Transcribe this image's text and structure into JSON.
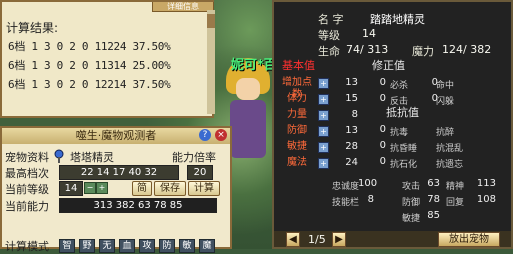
{
  "npc_name": "妮可*百",
  "calc": {
    "title": "计算结果:",
    "tab_label": "详细信息",
    "rows": [
      "6档 1 3 0 2 0 11224 37.50%",
      "6档 1 3 0 2 0 11314 25.00%",
      "6档 1 3 0 2 0 12214 37.50%"
    ]
  },
  "observer": {
    "title": "噬生·魔物观测者",
    "help_icon": "?",
    "close_icon": "×",
    "pet_info_label": "宠物资料",
    "pet_name": "塔塔精灵",
    "ability_rate_label": "能力倍率",
    "max_level_label": "最高档次",
    "max_level_value": "22 14 17 40 32",
    "max_level_extra": "20",
    "current_level_label": "当前等级",
    "current_level_value": "14",
    "btn_simple": "简",
    "btn_save": "保存",
    "btn_calc": "计算",
    "current_ability_label": "当前能力",
    "current_ability_value": "313 382 63 78 85",
    "mode_label": "计算模式",
    "modes": [
      "智",
      "野",
      "无",
      "血",
      "攻",
      "防",
      "敏",
      "魔"
    ]
  },
  "pet": {
    "name_label": "名 字",
    "name_value": "踏踏地精灵",
    "level_label": "等级",
    "level_value": "14",
    "hp_label": "生命",
    "hp_value": "74/ 313",
    "mp_label": "魔力",
    "mp_value": "124/ 382",
    "basic_head": "基本值",
    "modifier_head": "修正值",
    "resist_head": "抵抗值",
    "basic": [
      {
        "label": "增加点数",
        "value": "13"
      },
      {
        "label": "体力",
        "value": "15"
      },
      {
        "label": "力量",
        "value": "8"
      },
      {
        "label": "防御",
        "value": "13"
      },
      {
        "label": "敏捷",
        "value": "28"
      },
      {
        "label": "魔法",
        "value": "24"
      }
    ],
    "modifier": [
      {
        "label": "必杀",
        "value": "0",
        "label2": "命中",
        "value2": "0"
      },
      {
        "label": "反击",
        "value": "0",
        "label2": "闪躲",
        "value2": "0"
      }
    ],
    "resist": [
      {
        "label": "抗毒",
        "value": "0",
        "label2": "抗醉",
        "value2": ""
      },
      {
        "label": "抗昏睡",
        "value": "0",
        "label2": "抗混乱",
        "value2": ""
      },
      {
        "label": "抗石化",
        "value": "0",
        "label2": "抗遗忘",
        "value2": ""
      }
    ],
    "loyalty_label": "忠诚度",
    "loyalty_value": "100",
    "skill_label": "技能栏",
    "skill_value": "8",
    "atk_label": "攻击",
    "atk_value": "63",
    "def_label": "防御",
    "def_value": "78",
    "agi_label": "敏捷",
    "agi_value": "85",
    "spirit_label": "精神",
    "spirit_value": "113",
    "recover_label": "回复",
    "recover_value": "108",
    "page": "1/5",
    "release_btn": "放出宠物"
  },
  "colors": {
    "basic_head": "#ff3030",
    "modifier_head": "#e8e8e8",
    "attr_label": "#ff6a3a",
    "panel_border": "#8a6a3a"
  }
}
